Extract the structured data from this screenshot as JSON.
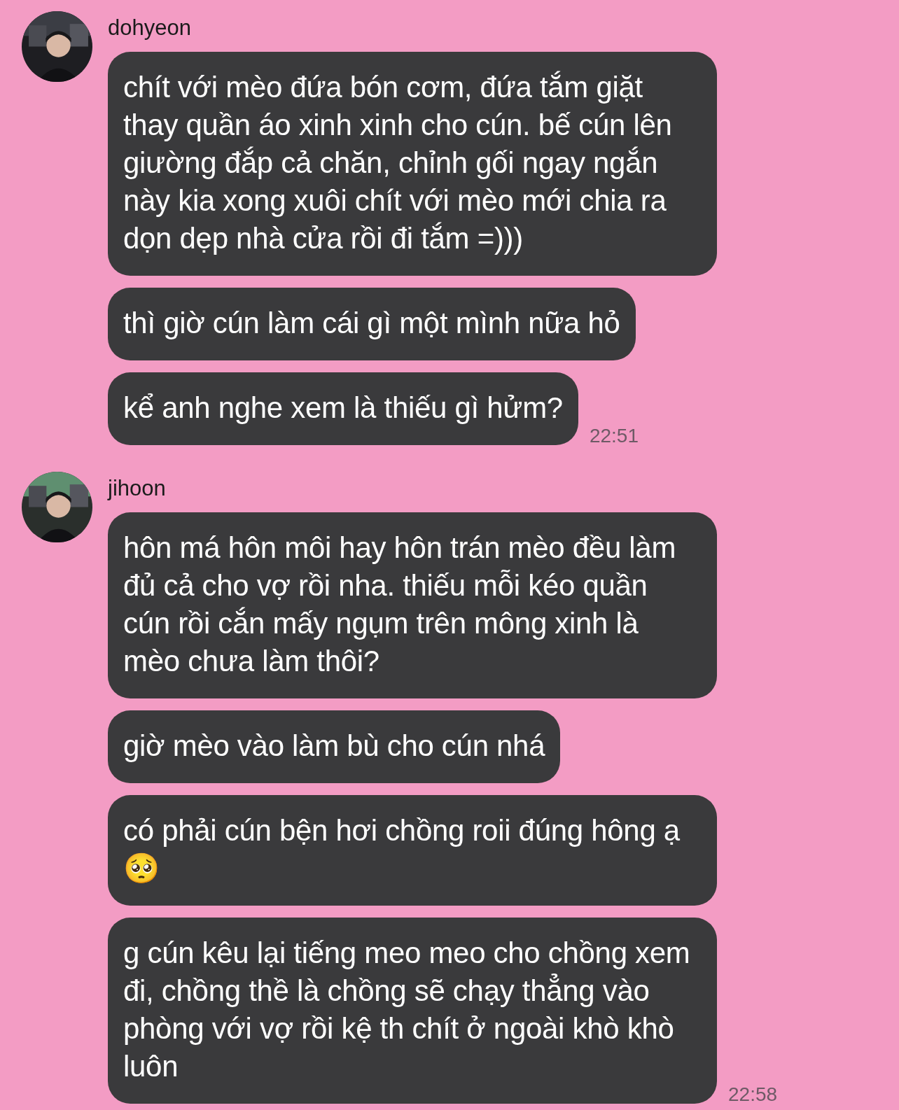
{
  "groups": [
    {
      "sender": "dohyeon",
      "avatar": {
        "kind": "picture"
      },
      "messages": [
        "chít với mèo đứa bón cơm, đứa tắm giặt thay quần áo xinh xinh cho cún. bế cún lên giường đắp cả chăn, chỉnh gối ngay ngắn này kia xong xuôi chít với mèo mới chia ra dọn dẹp nhà cửa rồi đi tắm =)))",
        "thì giờ cún làm cái gì một mình nữa hỏ",
        "kể anh nghe xem là thiếu gì hửm?"
      ],
      "time": "22:51"
    },
    {
      "sender": "jihoon",
      "avatar": {
        "kind": "picture"
      },
      "messages": [
        "hôn má hôn môi hay hôn trán mèo đều làm đủ cả cho vợ rồi nha. thiếu mỗi kéo quần cún rồi cắn mấy ngụm trên mông xinh là mèo chưa làm thôi?",
        "giờ mèo vào làm bù cho cún nhá",
        "có phải cún bện hơi chồng roii đúng hông ạ🥺",
        "g cún kêu lại tiếng meo meo cho chồng xem đi, chồng thề là chồng sẽ chạy thẳng vào phòng với vợ rồi kệ th chít ở ngoài khò khò luôn"
      ],
      "time": "22:58"
    }
  ]
}
